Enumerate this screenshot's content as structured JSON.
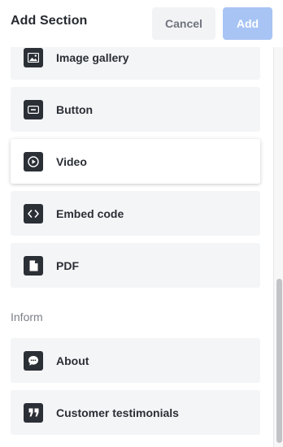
{
  "header": {
    "title": "Add Section",
    "cancel_label": "Cancel",
    "add_label": "Add"
  },
  "items_group_1": [
    {
      "label": "Image gallery",
      "icon": "image-icon"
    },
    {
      "label": "Button",
      "icon": "button-icon"
    },
    {
      "label": "Video",
      "icon": "play-icon",
      "selected": true
    },
    {
      "label": "Embed code",
      "icon": "code-icon"
    },
    {
      "label": "PDF",
      "icon": "document-icon"
    }
  ],
  "section_inform": {
    "label": "Inform",
    "items": [
      {
        "label": "About",
        "icon": "chat-bubble-icon"
      },
      {
        "label": "Customer testimonials",
        "icon": "quote-icon"
      }
    ]
  },
  "colors": {
    "primary_disabled": "#a8c4f4",
    "item_background": "#f4f5f7",
    "icon_background": "#2b2f36"
  }
}
